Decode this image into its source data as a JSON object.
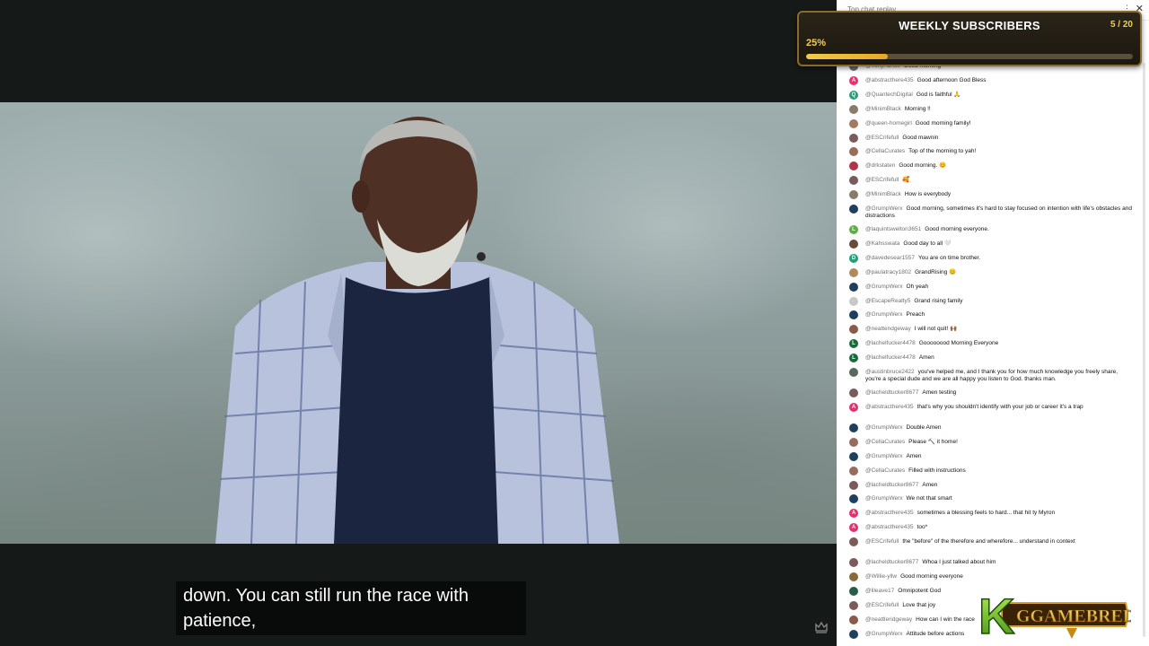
{
  "caption": {
    "line1": "down. You can still run the race with",
    "line2": "patience,"
  },
  "goal_widget": {
    "title": "WEEKLY SUBSCRIBERS",
    "count": "5 / 20",
    "percent": "25%",
    "progress_fraction": 0.25
  },
  "chat": {
    "header_title": "Top chat replay",
    "messages": [
      {
        "user": "@TonyAurice",
        "text": "Good morning",
        "avatar_color": "#6b6b6b",
        "initial": ""
      },
      {
        "user": "@abstracthere435",
        "text": "Good afternoon God Bless",
        "avatar_color": "#e8306e",
        "initial": "A"
      },
      {
        "user": "@QuantechDigital",
        "text": "God is faithful 🙏",
        "avatar_color": "#2d9c7a",
        "initial": "Q"
      },
      {
        "user": "@MinimBlack",
        "text": "Morning !!",
        "avatar_color": "#8a7a6a",
        "initial": ""
      },
      {
        "user": "@queen-homegirl",
        "text": "Good morning family!",
        "avatar_color": "#a27a63",
        "initial": ""
      },
      {
        "user": "@ESCrifefull",
        "text": "Good mawnin",
        "avatar_color": "#7a5a5a",
        "initial": ""
      },
      {
        "user": "@CellaCurates",
        "text": "Top of the morning to yah!",
        "avatar_color": "#9a6a5a",
        "initial": ""
      },
      {
        "user": "@drkstaten",
        "text": "Good morning. 😊",
        "avatar_color": "#b0344a",
        "initial": ""
      },
      {
        "user": "@ESCrifefull",
        "text": "🥰",
        "avatar_color": "#7a5a5a",
        "initial": ""
      },
      {
        "user": "@MinimBlack",
        "text": "How is everybody",
        "avatar_color": "#8a7a6a",
        "initial": ""
      },
      {
        "user": "@GrumpWerx",
        "text": "Good morning, sometimes it's hard to stay focused on intention with life's obstacles and distractions",
        "avatar_color": "#1f3f5f",
        "initial": ""
      },
      {
        "user": "@laquintswelton3651",
        "text": "Good morning everyone.",
        "avatar_color": "#5cb043",
        "initial": "L"
      },
      {
        "user": "@Kahsswata",
        "text": "Good day to all 🤍",
        "avatar_color": "#6a4a3a",
        "initial": ""
      },
      {
        "user": "@davedesear1557",
        "text": "You are on time brother.",
        "avatar_color": "#1aa37a",
        "initial": "D"
      },
      {
        "user": "@paulatracy1802",
        "text": "GrandRising 😊",
        "avatar_color": "#b08a5a",
        "initial": ""
      },
      {
        "user": "@GrumpWerx",
        "text": "Oh yeah",
        "avatar_color": "#1f3f5f",
        "initial": ""
      },
      {
        "user": "@EscapeRealty5",
        "text": "Grand rising family",
        "avatar_color": "#c8c8c8",
        "initial": ""
      },
      {
        "user": "@GrumpWerx",
        "text": "Preach",
        "avatar_color": "#1f3f5f",
        "initial": ""
      },
      {
        "user": "@neattendgeway",
        "text": "I will not quit! 🙌🏾",
        "avatar_color": "#8a5a4a",
        "initial": ""
      },
      {
        "user": "@lachelfucker4478",
        "text": "Goooooood Morning Everyone",
        "avatar_color": "#1b6b3a",
        "initial": "L"
      },
      {
        "user": "@lachelfucker4478",
        "text": "Amen",
        "avatar_color": "#1b6b3a",
        "initial": "L"
      },
      {
        "user": "@austinbruce2422",
        "text": "you've helped me, and I thank you for how much knowledge you freely share, you're a special dude and we are all happy you listen to God. thanks man.",
        "avatar_color": "#5a6a5a",
        "initial": ""
      },
      {
        "user": "@lacheldtucker8677",
        "text": "Amen testing",
        "avatar_color": "#7a5a5a",
        "initial": ""
      },
      {
        "user": "@abstracthere435",
        "text": "that's why you shouldn't identify with your job or career it's a trap",
        "avatar_color": "#e8306e",
        "initial": "A"
      },
      {
        "user": "@GrumpWerx",
        "text": "Double Amen",
        "avatar_color": "#1f3f5f",
        "initial": ""
      },
      {
        "user": "@CellaCurates",
        "text": "Please 🔨 it home!",
        "avatar_color": "#9a6a5a",
        "initial": ""
      },
      {
        "user": "@GrumpWerx",
        "text": "Amen",
        "avatar_color": "#1f3f5f",
        "initial": ""
      },
      {
        "user": "@CellaCurates",
        "text": "Filled with instructions",
        "avatar_color": "#9a6a5a",
        "initial": ""
      },
      {
        "user": "@lacheldtucker8677",
        "text": "Amen",
        "avatar_color": "#7a5a5a",
        "initial": ""
      },
      {
        "user": "@GrumpWerx",
        "text": "We not that smart",
        "avatar_color": "#1f3f5f",
        "initial": ""
      },
      {
        "user": "@abstracthere435",
        "text": "sometimes a blessing feels to hard... that hit ty Myron",
        "avatar_color": "#e8306e",
        "initial": "A"
      },
      {
        "user": "@abstracthere435",
        "text": "too*",
        "avatar_color": "#e8306e",
        "initial": "A"
      },
      {
        "user": "@ESCrifefull",
        "text": "the \"before\" of the therefore and wherefore... understand in context",
        "avatar_color": "#7a5a5a",
        "initial": ""
      },
      {
        "user": "@lacheldtucker8677",
        "text": "Whoa I just talked about him",
        "avatar_color": "#7a5a5a",
        "initial": ""
      },
      {
        "user": "@Willie-yllw",
        "text": "Good morning everyone",
        "avatar_color": "#8a6a3a",
        "initial": ""
      },
      {
        "user": "@lileave17",
        "text": "Omnipotent God",
        "avatar_color": "#2a5a4a",
        "initial": ""
      },
      {
        "user": "@ESCrifefull",
        "text": "Love that joy",
        "avatar_color": "#7a5a5a",
        "initial": ""
      },
      {
        "user": "@neattleridgeway",
        "text": "How can I win the race",
        "avatar_color": "#8a5a4a",
        "initial": ""
      },
      {
        "user": "@GrumpWerx",
        "text": "Attitude before actions",
        "avatar_color": "#1f3f5f",
        "initial": ""
      }
    ]
  },
  "logo": {
    "brand_text": "GGAMEBRED",
    "letter": "K"
  }
}
